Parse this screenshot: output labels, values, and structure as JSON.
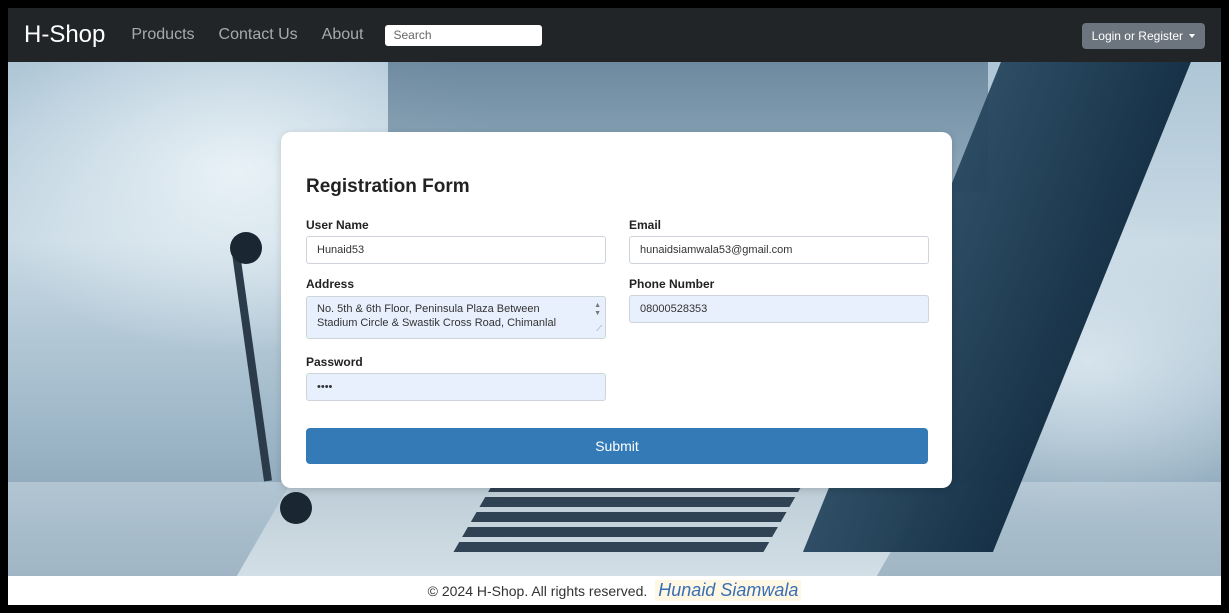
{
  "navbar": {
    "brand": "H-Shop",
    "links": [
      "Products",
      "Contact Us",
      "About"
    ],
    "search_placeholder": "Search",
    "login_label": "Login or Register"
  },
  "form": {
    "title": "Registration Form",
    "username_label": "User Name",
    "username_value": "Hunaid53",
    "email_label": "Email",
    "email_value": "hunaidsiamwala53@gmail.com",
    "address_label": "Address",
    "address_line1": "No. 5th & 6th Floor, Peninsula Plaza Between",
    "address_line2": "Stadium Circle & Swastik Cross Road, Chimanlal",
    "phone_label": "Phone Number",
    "phone_value": "08000528353",
    "password_label": "Password",
    "password_value": "••••",
    "submit_label": "Submit"
  },
  "footer": {
    "copyright": "© 2024 H-Shop. All rights reserved.",
    "author": "Hunaid Siamwala"
  },
  "colors": {
    "navbar_bg": "#222527",
    "submit_bg": "#337ab7",
    "login_bg": "#6c757d",
    "autofill_bg": "#e8f0fe"
  }
}
